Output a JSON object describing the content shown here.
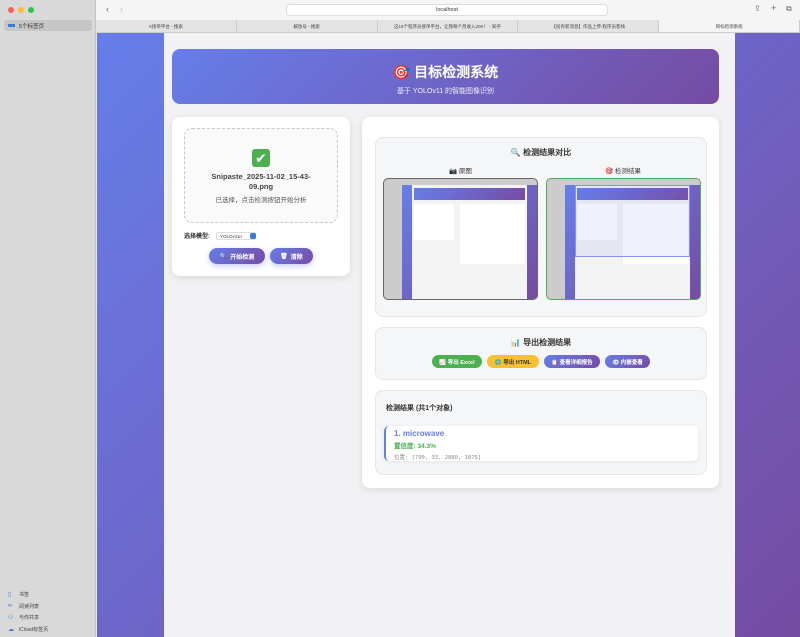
{
  "browser": {
    "url": "localhost",
    "sidebar_tab_group": "5个标签页",
    "tabs": [
      "X接单平台 - 搜索",
      "解放号 - 搜索",
      "这15个程序员接单平台，让我每个月收入20K！ - 知乎",
      "【投有新消息】作品上传-程序员客栈",
      "目标检测系统"
    ],
    "sidebar_bottom": [
      "书签",
      "阅读列表",
      "与你共享",
      "iCloud标签页"
    ]
  },
  "header": {
    "icon": "🎯",
    "title": "目标检测系统",
    "subtitle": "基于 YOLOv11 的智能图像识别"
  },
  "upload": {
    "icon": "✔",
    "filename": "Snipaste_2025-11-02_15-43-09.png",
    "hint": "已选择，点击检测按钮开始分析",
    "model_label": "选择模型:",
    "model_value": "YOLOv11n",
    "detect_button": "开始检测",
    "clear_button": "清除"
  },
  "compare": {
    "title": "🔍 检测结果对比",
    "original_label": "📷 原图",
    "result_label": "🎯 检测结果"
  },
  "export": {
    "title": "📊 导出检测结果",
    "buttons": [
      "📈 导出 Excel",
      "🌐 导出 HTML",
      "📋 查看详细报告",
      "👁 内嵌查看"
    ],
    "colors": [
      "#4caf50",
      "#fbc02d",
      "#6a5acd",
      "#6a5acd"
    ]
  },
  "results": {
    "title": "检测结果 (共1个对象)",
    "items": [
      {
        "name": "1. microwave",
        "confidence": "置信度: 34.3%",
        "position": "位置: [790, 33, 2880, 1875]"
      }
    ]
  }
}
